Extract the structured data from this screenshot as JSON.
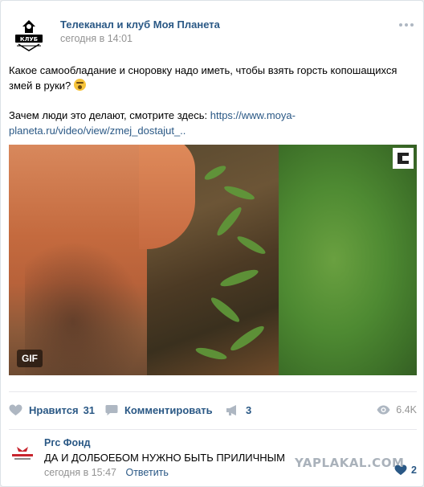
{
  "post": {
    "author": "Телеканал и клуб Моя Планета",
    "date": "сегодня в 14:01",
    "avatar_label": "КЛУБ МОЯ ПЛАНЕТА",
    "text_line1": "Какое самообладание и сноровку надо иметь, чтобы взять горсть копошащихся змей в руки?",
    "text_line2_prefix": "Зачем люди это делают, смотрите здесь: ",
    "link_text": "https://www.moya-planeta.ru/video/view/zmej_dostajut_..",
    "gif_label": "GIF",
    "emoji": "scared-face-emoji"
  },
  "actions": {
    "like_label": "Нравится",
    "like_count": "31",
    "comment_label": "Комментировать",
    "share_count": "3",
    "views": "6.4K"
  },
  "comment": {
    "author": "Ргс Фонд",
    "text": "ДА И ДОЛБОЕБОМ НУЖНО БЫТЬ ПРИЛИЧНЫМ",
    "date": "сегодня в 15:47",
    "reply_label": "Ответить",
    "like_count": "2",
    "avatar_label": "РОСГОССТРАХ ПЕНСИЯ"
  },
  "watermark": "YAPLAKAL.COM",
  "colors": {
    "link": "#2a5885",
    "muted": "#939393",
    "border": "#dce1e6"
  }
}
